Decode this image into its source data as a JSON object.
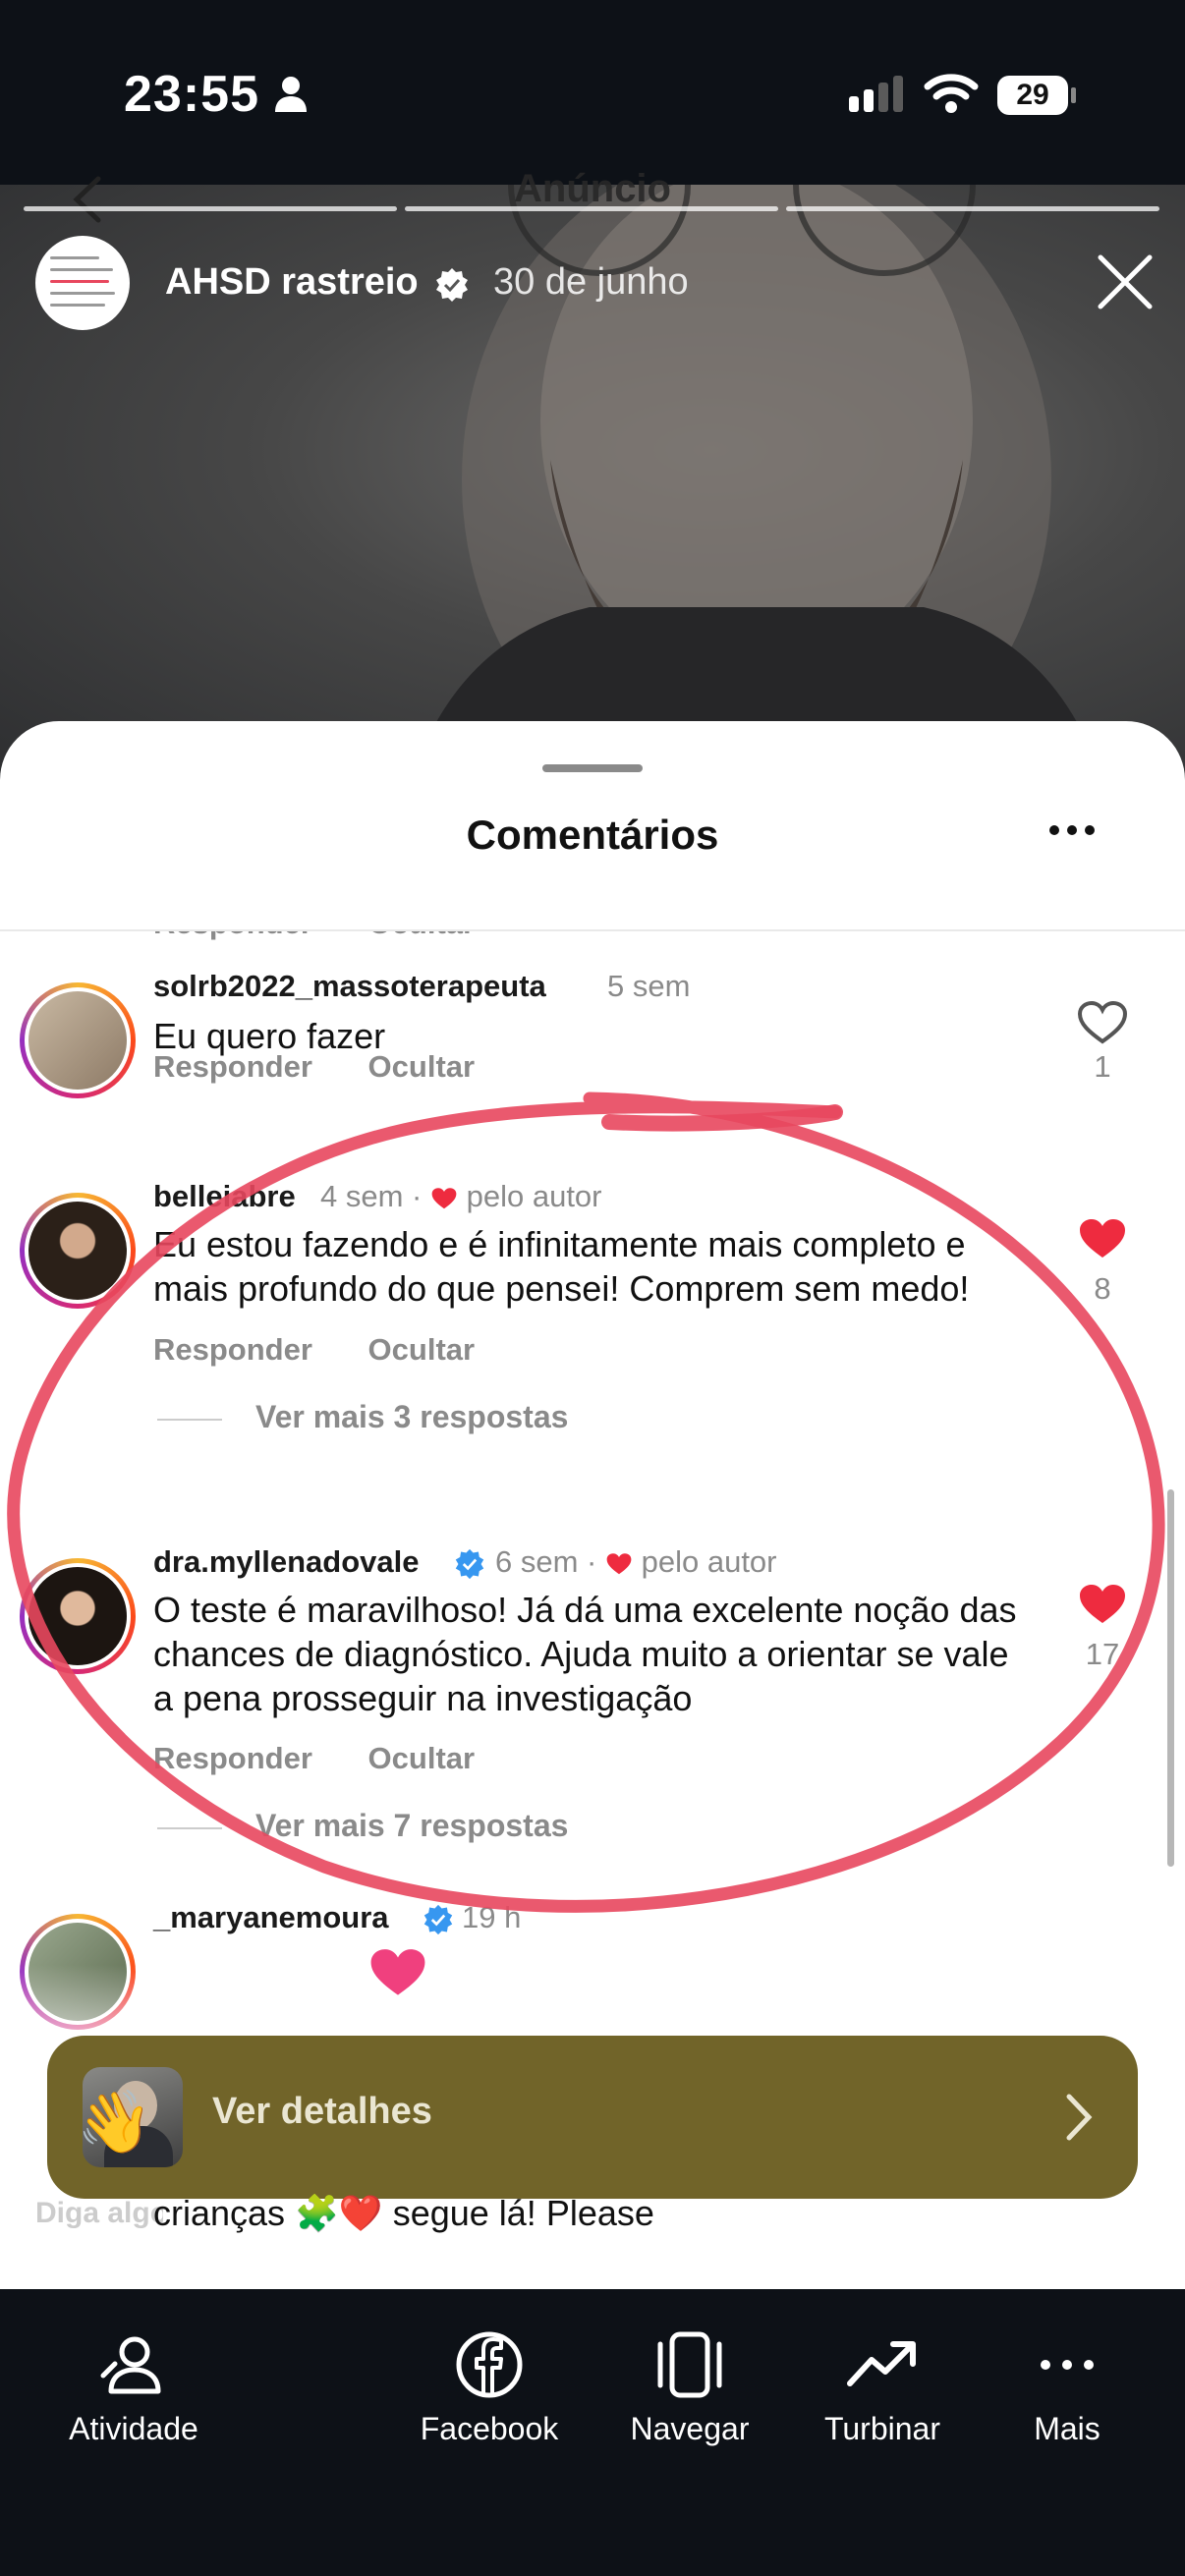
{
  "status_bar": {
    "time": "23:55",
    "battery": "29"
  },
  "story": {
    "header_title": "Anúncio",
    "username": "AHSD rastreio",
    "date": "30 de junho"
  },
  "sheet": {
    "title": "Comentários",
    "partial_actions": {
      "reply": "Responder",
      "hide": "Ocultar"
    },
    "comments": [
      {
        "username": "solrb2022_massoterapeuta",
        "time": "5 sem",
        "text": "Eu quero fazer",
        "reply": "Responder",
        "hide": "Ocultar",
        "likes": "1",
        "liked": false
      },
      {
        "username": "belleiabre",
        "time": "4 sem",
        "by_author": "pelo autor",
        "text": "Eu estou fazendo e é infinitamente mais completo e mais profundo do que pensei! Comprem sem medo!",
        "reply": "Responder",
        "hide": "Ocultar",
        "more_replies": "Ver mais 3 respostas",
        "likes": "8",
        "liked": true
      },
      {
        "username": "dra.myllenadovale",
        "time": "6 sem",
        "by_author": "pelo autor",
        "text": "O teste é maravilhoso! Já dá uma excelente noção das chances de diagnóstico. Ajuda muito a orientar se vale a pena prosseguir na investigação",
        "reply": "Responder",
        "hide": "Ocultar",
        "more_replies": "Ver mais 7 respostas",
        "likes": "17",
        "liked": true
      },
      {
        "username": "_maryanemoura",
        "time": "19 h"
      }
    ],
    "details_button": "Ver detalhes",
    "input_placeholder": "Diga algo...",
    "partial_text": "crianças 🧩❤️ segue lá! Please"
  },
  "bottom_nav": [
    {
      "label": "Atividade",
      "icon": "activity-icon"
    },
    {
      "label": "Facebook",
      "icon": "facebook-icon"
    },
    {
      "label": "Navegar",
      "icon": "browse-icon"
    },
    {
      "label": "Turbinar",
      "icon": "boost-icon"
    },
    {
      "label": "Mais",
      "icon": "more-icon"
    }
  ],
  "colors": {
    "background_dark": "#0d1117",
    "details_bar": "#716429",
    "heart_red": "#ee2b3f",
    "verified_blue": "#3797f0",
    "scribble": "#e8475e"
  }
}
